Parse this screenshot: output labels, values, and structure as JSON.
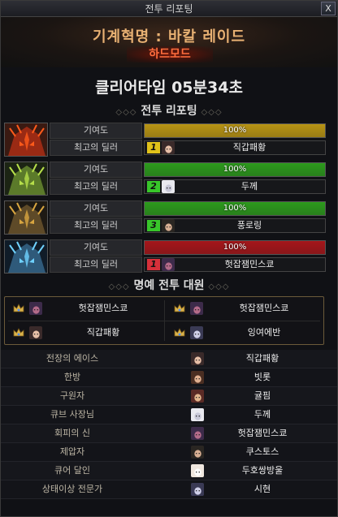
{
  "window": {
    "title": "전투 리포팅",
    "close_label": "X"
  },
  "header": {
    "raid_title": "기계혁명 : 바칼 레이드",
    "mode": "하드모드"
  },
  "clear_time": "클리어타임  05분34초",
  "sections": {
    "report_title": "전투 리포팅",
    "honor_title": "명예 전투 대원",
    "ornament_left": "◇◇◇",
    "ornament_right": "◇◇◇"
  },
  "reports": [
    {
      "contribution_label": "기여도",
      "contribution_value": "100%",
      "contribution_fraction": 1.0,
      "bar_color": "#b89414",
      "dealer_label": "최고의 딜러",
      "rank": "1",
      "rank_color": "#e0c21a",
      "dealer_name": "직갑패황",
      "boss_icon": "fire-mech-boss-icon"
    },
    {
      "contribution_label": "기여도",
      "contribution_value": "100%",
      "contribution_fraction": 1.0,
      "bar_color": "#2c9a1c",
      "dealer_label": "최고의 딜러",
      "rank": "2",
      "rank_color": "#38c62a",
      "dealer_name": "두께",
      "boss_icon": "green-mech-boss-icon"
    },
    {
      "contribution_label": "기여도",
      "contribution_value": "100%",
      "contribution_fraction": 1.0,
      "bar_color": "#2c9a1c",
      "dealer_label": "최고의 딜러",
      "rank": "3",
      "rank_color": "#38c62a",
      "dealer_name": "풍로링",
      "boss_icon": "gold-mech-boss-icon"
    },
    {
      "contribution_label": "기여도",
      "contribution_value": "100%",
      "contribution_fraction": 1.0,
      "bar_color": "#a5161a",
      "dealer_label": "최고의 딜러",
      "rank": "1",
      "rank_color": "#d6303a",
      "dealer_name": "헛잡잼민스쿄",
      "boss_icon": "ice-mech-boss-icon"
    }
  ],
  "honor": [
    {
      "name": "헛잡잼민스쿄",
      "crown": "crown-icon"
    },
    {
      "name": "헛잡잼민스쿄",
      "crown": "crown-icon"
    },
    {
      "name": "직갑패황",
      "crown": "crown-icon"
    },
    {
      "name": "잉여에반",
      "crown": "crown-icon"
    }
  ],
  "titles": [
    {
      "label": "전장의 에이스",
      "name": "직갑패황"
    },
    {
      "label": "한방",
      "name": "빗롯"
    },
    {
      "label": "구원자",
      "name": "귤핌"
    },
    {
      "label": "큐브 사장님",
      "name": "두께"
    },
    {
      "label": "회피의 신",
      "name": "헛잡잼민스쿄"
    },
    {
      "label": "제압자",
      "name": "쿠스토스"
    },
    {
      "label": "큐어 달인",
      "name": "두호쌍방울"
    },
    {
      "label": "상태이상 전문가",
      "name": "시현"
    }
  ]
}
